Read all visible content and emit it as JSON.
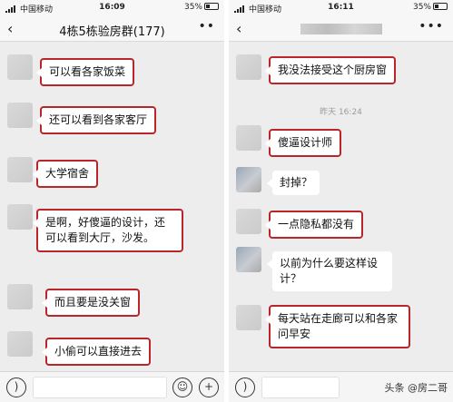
{
  "left": {
    "status": {
      "carrier": "中国移动",
      "time": "16:09",
      "battery": "35%"
    },
    "title": "4栋5栋验房群(177)",
    "messages": [
      "可以看各家饭菜",
      "还可以看到各家客厅",
      "大学宿舍",
      "是啊，好傻逼的设计，还可以看到大厅，沙发。",
      "而且要是没关窗",
      "小偷可以直接进去"
    ]
  },
  "right": {
    "status": {
      "carrier": "中国移动",
      "time": "16:11",
      "battery": "35%"
    },
    "timestamp": "昨天 16:24",
    "messages": [
      "我没法接受这个厨房窗",
      "傻逼设计师",
      "封掉？",
      "一点隐私都没有",
      "以前为什么要这样设计？",
      "每天站在走廊可以和各家问早安"
    ]
  },
  "icons": {
    "back": "back-chevron-icon",
    "voice": "voice-icon",
    "emoji": "emoji-icon",
    "add": "add-icon",
    "more": "more-icon"
  },
  "watermark": "头条 @房二哥",
  "colors": {
    "highlight": "#b8262a",
    "chat_bg": "#ededed"
  }
}
